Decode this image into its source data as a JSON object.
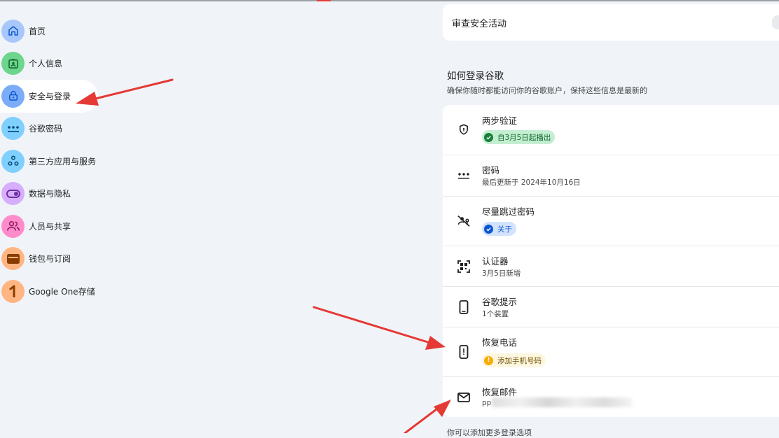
{
  "sidebar": {
    "items": [
      {
        "label": "首页",
        "icon": "home-icon",
        "color": "#a8c7fa",
        "active": false
      },
      {
        "label": "个人信息",
        "icon": "id-card-icon",
        "color": "#6dd58c",
        "active": false
      },
      {
        "label": "安全与登录",
        "icon": "lock-icon",
        "color": "#7cacf8",
        "active": true
      },
      {
        "label": "谷歌密码",
        "icon": "password-dots-icon",
        "color": "#7fcfff",
        "active": false
      },
      {
        "label": "第三方应用与服务",
        "icon": "apps-network-icon",
        "color": "#7fcfff",
        "active": false
      },
      {
        "label": "数据与隐私",
        "icon": "toggle-icon",
        "color": "#d7aefb",
        "active": false
      },
      {
        "label": "人员与共享",
        "icon": "people-icon",
        "color": "#ff8bcb",
        "active": false
      },
      {
        "label": "钱包与订阅",
        "icon": "wallet-icon",
        "color": "#ffb683",
        "active": false
      },
      {
        "label": "Google One存储",
        "icon": "google-one-icon",
        "color": "#ffb683",
        "active": false
      }
    ]
  },
  "review": {
    "label": "审查安全活动"
  },
  "signin": {
    "title": "如何登录谷歌",
    "description": "确保你随时都能访问你的谷歌账户，保持这些信息是最新的"
  },
  "rows": {
    "two_step": {
      "title": "两步验证",
      "chip": "自3月5日起播出",
      "icon": "shield-icon"
    },
    "password": {
      "title": "密码",
      "sub": "最后更新于 2024年10月16日",
      "icon": "password-dots-icon"
    },
    "skip_password": {
      "title": "尽量跳过密码",
      "chip": "关于",
      "icon": "passkey-off-icon"
    },
    "authenticator": {
      "title": "认证器",
      "sub": "3月5日新增",
      "icon": "qr-code-icon"
    },
    "prompts": {
      "title": "谷歌提示",
      "sub": "1个装置",
      "icon": "phone-icon"
    },
    "recovery_phone": {
      "title": "恢复电话",
      "chip": "添加手机号码",
      "icon": "phone-alert-icon"
    },
    "recovery_email": {
      "title": "恢复邮件",
      "sub": "pp",
      "icon": "mail-icon"
    }
  },
  "footer": {
    "hint": "你可以添加更多登录选项"
  },
  "colors": {
    "background": "#f0f4f9",
    "annotation_arrow": "#e53935"
  }
}
